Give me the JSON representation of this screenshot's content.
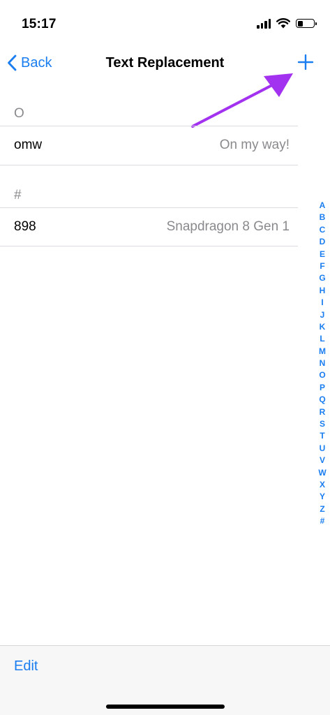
{
  "status_bar": {
    "time": "15:17"
  },
  "nav": {
    "back_label": "Back",
    "title": "Text Replacement",
    "add_icon": "plus-icon"
  },
  "sections": [
    {
      "header": "O",
      "rows": [
        {
          "shortcut": "omw",
          "phrase": "On my way!"
        }
      ]
    },
    {
      "header": "#",
      "rows": [
        {
          "shortcut": "898",
          "phrase": "Snapdragon 8 Gen 1"
        }
      ]
    }
  ],
  "index": [
    "A",
    "B",
    "C",
    "D",
    "E",
    "F",
    "G",
    "H",
    "I",
    "J",
    "K",
    "L",
    "M",
    "N",
    "O",
    "P",
    "Q",
    "R",
    "S",
    "T",
    "U",
    "V",
    "W",
    "X",
    "Y",
    "Z",
    "#"
  ],
  "toolbar": {
    "edit_label": "Edit"
  },
  "colors": {
    "accent": "#1a7df0",
    "annotation_arrow": "#a331f0",
    "secondary_text": "#8a8a8e"
  }
}
